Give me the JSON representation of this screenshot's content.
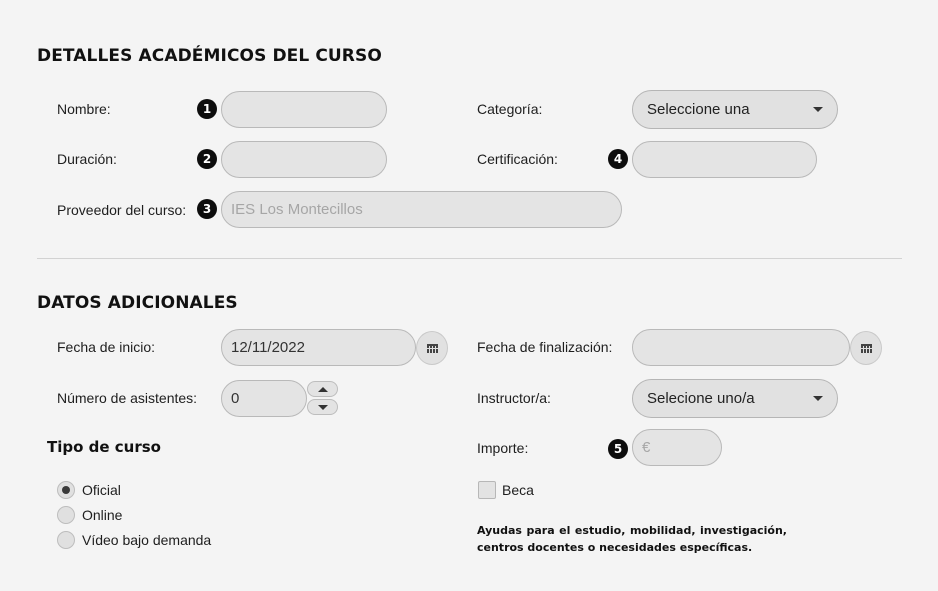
{
  "section1": {
    "title": "DETALLES ACADÉMICOS DEL CURSO",
    "nombre_label": "Nombre:",
    "duracion_label": "Duración:",
    "proveedor_label": "Proveedor del curso:",
    "proveedor_placeholder": "IES Los Montecillos",
    "categoria_label": "Categoría:",
    "categoria_value": "Seleccione una",
    "certificacion_label": "Certificación:"
  },
  "badges": [
    "1",
    "2",
    "3",
    "4",
    "5"
  ],
  "section2": {
    "title": "DATOS ADICIONALES",
    "fecha_inicio_label": "Fecha de inicio:",
    "fecha_inicio_value": "12/11/2022",
    "fecha_fin_label": "Fecha de finalización:",
    "asistentes_label": "Número de asistentes:",
    "asistentes_value": "0",
    "instructor_label": "Instructor/a:",
    "instructor_value": "Selecione uno/a",
    "tipo_title": "Tipo de curso",
    "tipo_options": [
      "Oficial",
      "Online",
      "Vídeo bajo demanda"
    ],
    "tipo_selected": "Oficial",
    "importe_label": "Importe:",
    "importe_placeholder": "€",
    "beca_label": "Beca",
    "beca_checked": false,
    "note": "Ayudas para el estudio, mobilidad, investigación, centros docentes o necesidades específicas."
  }
}
